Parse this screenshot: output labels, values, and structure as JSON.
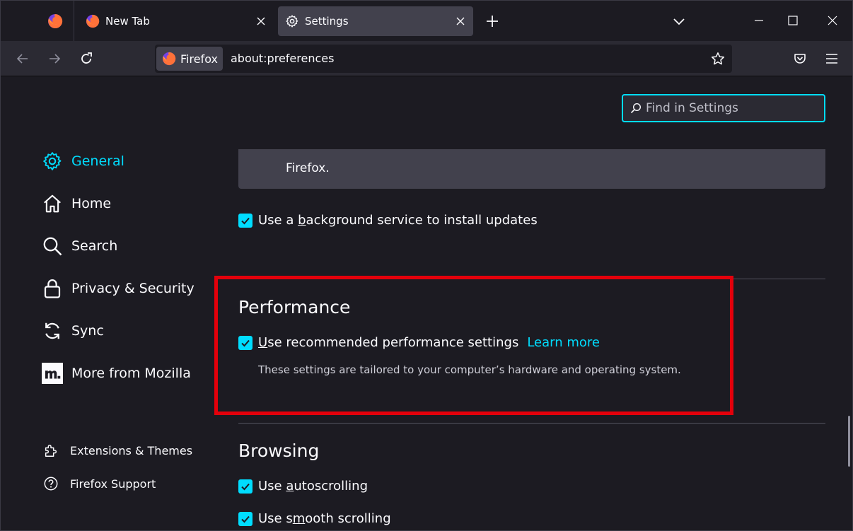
{
  "window": {
    "tabs": [
      {
        "title": "New Tab",
        "active": false
      },
      {
        "title": "Settings",
        "active": true
      }
    ]
  },
  "navbar": {
    "identity_label": "Firefox",
    "url": "about:preferences"
  },
  "search": {
    "placeholder": "Find in Settings"
  },
  "sidebar": {
    "categories": [
      {
        "label": "General",
        "icon": "gear-icon",
        "selected": true
      },
      {
        "label": "Home",
        "icon": "home-icon"
      },
      {
        "label": "Search",
        "icon": "magnifier-icon"
      },
      {
        "label": "Privacy & Security",
        "icon": "lock-icon"
      },
      {
        "label": "Sync",
        "icon": "sync-icon"
      },
      {
        "label": "More from Mozilla",
        "icon": "mozilla-m-icon"
      }
    ],
    "footer": [
      {
        "label": "Extensions & Themes",
        "icon": "puzzle-icon"
      },
      {
        "label": "Firefox Support",
        "icon": "help-icon"
      }
    ]
  },
  "main": {
    "info_box_text": "Firefox.",
    "updates": {
      "background_service": {
        "pre": "Use a ",
        "accel": "b",
        "post": "ackground service to install updates",
        "checked": true
      }
    },
    "performance": {
      "title": "Performance",
      "recommended": {
        "accel": "U",
        "post": "se recommended performance settings",
        "checked": true
      },
      "learn_more": "Learn more",
      "description": "These settings are tailored to your computer’s hardware and operating system."
    },
    "browsing": {
      "title": "Browsing",
      "autoscrolling": {
        "pre": "Use ",
        "accel": "a",
        "post": "utoscrolling",
        "checked": true
      },
      "smooth_scrolling": {
        "pre": "Use s",
        "accel": "m",
        "post": "ooth scrolling",
        "checked": true
      }
    }
  },
  "colors": {
    "accent": "#00ddff",
    "highlight_box": "#e3000b",
    "background": "#1c1b22"
  }
}
